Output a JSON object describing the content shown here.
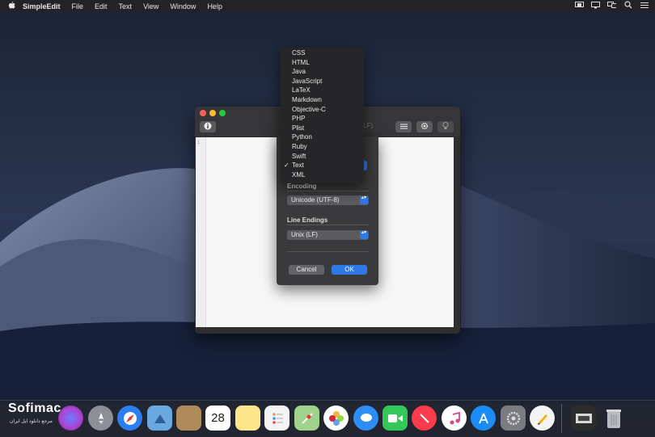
{
  "menubar": {
    "app_name": "SimpleEdit",
    "items": [
      "File",
      "Edit",
      "Text",
      "View",
      "Window",
      "Help"
    ],
    "status_icons": [
      "apple-logo-icon",
      "display-mirroring-icon",
      "monitor-icon",
      "airplay-icon",
      "search-icon",
      "control-center-icon"
    ]
  },
  "window": {
    "ghost_title": "LF)",
    "gutter_line": "1",
    "toolbar_icons": [
      "info-icon",
      "lines-icon",
      "gear-icon",
      "lightbulb-icon"
    ]
  },
  "language_menu": {
    "items": [
      "CSS",
      "HTML",
      "Java",
      "JavaScript",
      "LaTeX",
      "Markdown",
      "Objective-C",
      "PHP",
      "Plist",
      "Python",
      "Ruby",
      "Swift",
      "Text",
      "XML"
    ],
    "checked": "Text",
    "check_mark": "✓"
  },
  "sheet": {
    "encoding_label": "Encoding",
    "encoding_value": "Unicode (UTF-8)",
    "line_endings_label": "Line Endings",
    "line_endings_value": "Unix (LF)",
    "cancel_label": "Cancel",
    "ok_label": "OK",
    "popup_arrows": "▴▾"
  },
  "brand": {
    "name": "Sofimac",
    "subtitle": "مرجع دانلود اپل ایران"
  },
  "dock": {
    "apps": [
      "siri",
      "launchpad",
      "safari",
      "mail-stamp",
      "notebook",
      "calendar",
      "notes",
      "reminders",
      "maps",
      "photos",
      "messages",
      "facetime",
      "news",
      "itunes",
      "app-store",
      "system-preferences",
      "simpleedit"
    ],
    "calendar_date": "28",
    "trash": "trash-icon"
  },
  "colors": {
    "accent": "#2f78e8",
    "window_bg": "#2f2f31",
    "editor_bg": "#f7f7f7"
  }
}
